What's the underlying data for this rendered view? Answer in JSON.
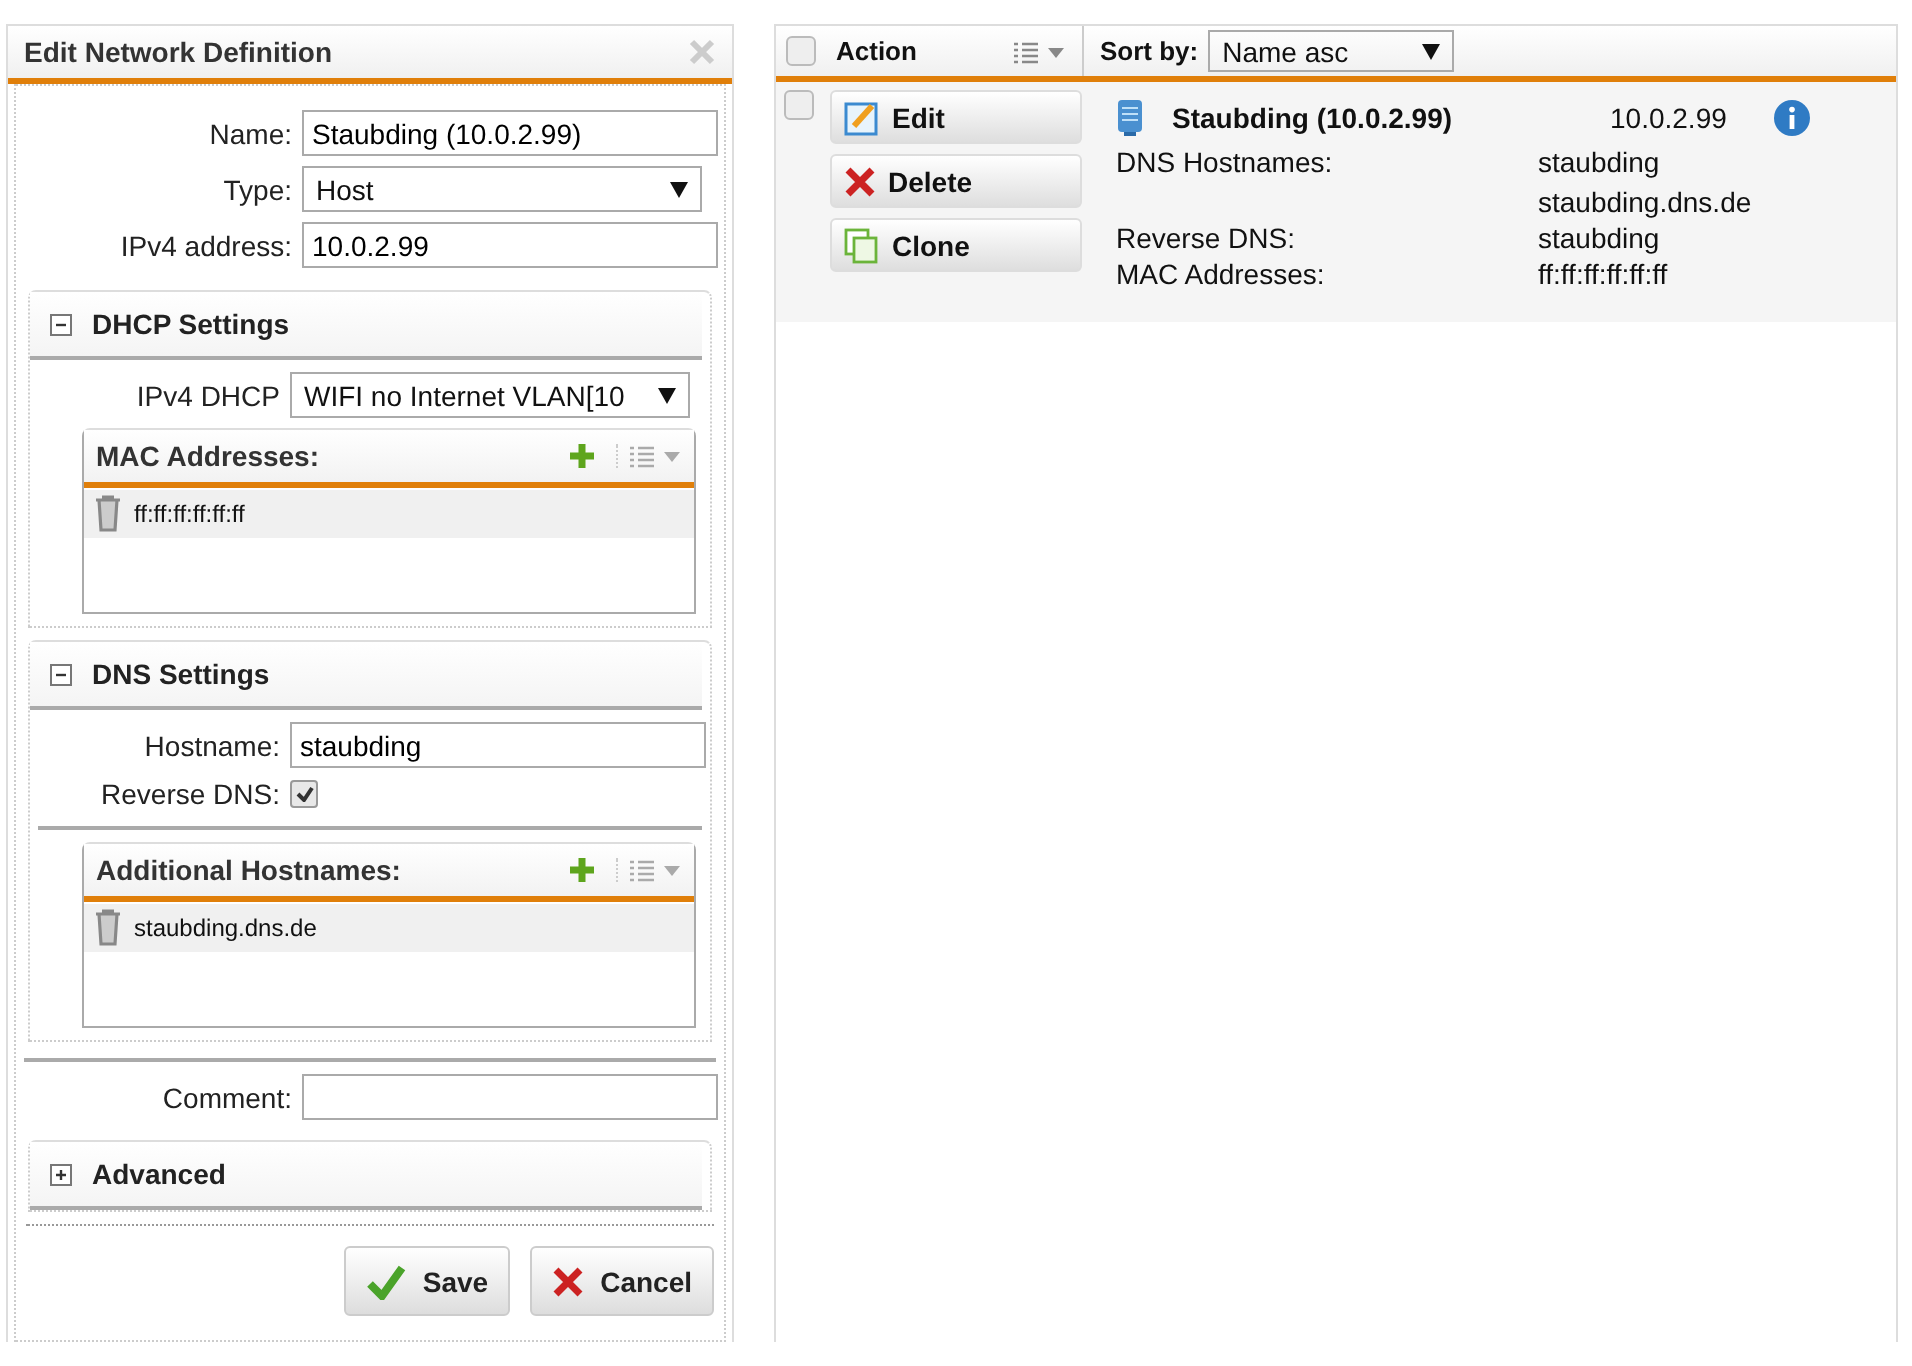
{
  "dialog": {
    "title": "Edit Network Definition",
    "fields": [
      {
        "label": "Name:",
        "value": "Staubding (10.0.2.99)",
        "kind": "text"
      },
      {
        "label": "Type:",
        "value": "Host",
        "kind": "select"
      },
      {
        "label": "IPv4 address:",
        "value": "10.0.2.99",
        "kind": "text"
      }
    ],
    "sections": [
      {
        "kind": "dhcp",
        "title": "DHCP Settings",
        "expanded": true,
        "field": {
          "label": "IPv4 DHCP",
          "value": "WIFI no Internet VLAN[10"
        },
        "list": {
          "title": "MAC Addresses:",
          "items": [
            "ff:ff:ff:ff:ff:ff"
          ]
        }
      },
      {
        "kind": "dns",
        "title": "DNS Settings",
        "expanded": true,
        "field": {
          "label": "Hostname:",
          "value": "staubding"
        },
        "check": {
          "label": "Reverse DNS:",
          "checked": true
        },
        "list": {
          "title": "Additional Hostnames:",
          "items": [
            "staubding.dns.de"
          ]
        }
      }
    ],
    "comment": {
      "label": "Comment:"
    },
    "advanced": {
      "title": "Advanced",
      "expanded": false
    },
    "buttons": [
      {
        "label": "Save",
        "kind": "ok"
      },
      {
        "label": "Cancel",
        "kind": "cancel"
      }
    ]
  },
  "list": {
    "select_all": false,
    "action_label": "Action",
    "sort_label": "Sort by:",
    "sort_value": "Name asc",
    "rows": [
      {
        "checked": false,
        "actions": [
          {
            "label": "Edit",
            "kind": "edit"
          },
          {
            "label": "Delete",
            "kind": "delete"
          },
          {
            "label": "Clone",
            "kind": "clone"
          }
        ],
        "name": "Staubding (10.0.2.99)",
        "address": "10.0.2.99",
        "details": [
          {
            "label": "DNS Hostnames:",
            "values": [
              "staubding",
              "staubding.dns.de"
            ]
          },
          {
            "label": "Reverse DNS:",
            "values": [
              "staubding"
            ]
          },
          {
            "label": "MAC Addresses:",
            "values": [
              "ff:ff:ff:ff:ff:ff"
            ]
          }
        ]
      }
    ]
  }
}
